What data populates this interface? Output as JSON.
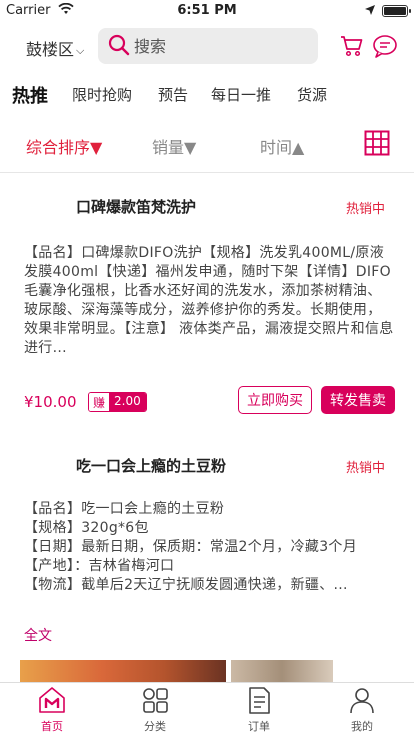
{
  "status_bar": {
    "carrier": "Carrier",
    "time": "6:51 PM"
  },
  "header": {
    "district": "鼓楼区",
    "search_placeholder": "搜索"
  },
  "category_tabs": [
    "热推",
    "限时抢购",
    "预告",
    "每日一推",
    "货源"
  ],
  "sort_bar": {
    "items": [
      "综合排序▼",
      "销量▼",
      "时间▲"
    ],
    "active_index": 0
  },
  "products": [
    {
      "title": "口碑爆款笛梵洗护",
      "badge": "热销中",
      "description": "【品名】口碑爆款DIFO洗护【规格】洗发乳400ML/原液发膜400ml【快递】福州发申通，随时下架【详情】DIFO毛囊净化强根，比香水还好闻的洗发水，添加茶树精油、玻尿酸、深海藻等成分，滋养修护你的秀发。长期使用，效果非常明显。【注意】 液体类产品，漏液提交照片和信息进行...",
      "price": "¥10.00",
      "earn_label": "赚",
      "earn_value": "2.00",
      "buy_label": "立即购买",
      "resell_label": "转发售卖"
    },
    {
      "title": "吃一口会上瘾的土豆粉",
      "badge": "热销中",
      "description": "【品名】吃一口会上瘾的土豆粉\n【规格】320g*6包\n【日期】最新日期，保质期：常温2个月，冷藏3个月\n【产地】：吉林省梅河口\n【物流】截单后2天辽宁抚顺发圆通快递，新疆、...",
      "fulltext_label": "全文"
    }
  ],
  "tab_bar": [
    {
      "label": "首页",
      "icon": "home-icon"
    },
    {
      "label": "分类",
      "icon": "category-icon"
    },
    {
      "label": "订单",
      "icon": "order-icon"
    },
    {
      "label": "我的",
      "icon": "profile-icon"
    }
  ],
  "colors": {
    "accent": "#d8005b",
    "sort_active": "#e0213c"
  }
}
